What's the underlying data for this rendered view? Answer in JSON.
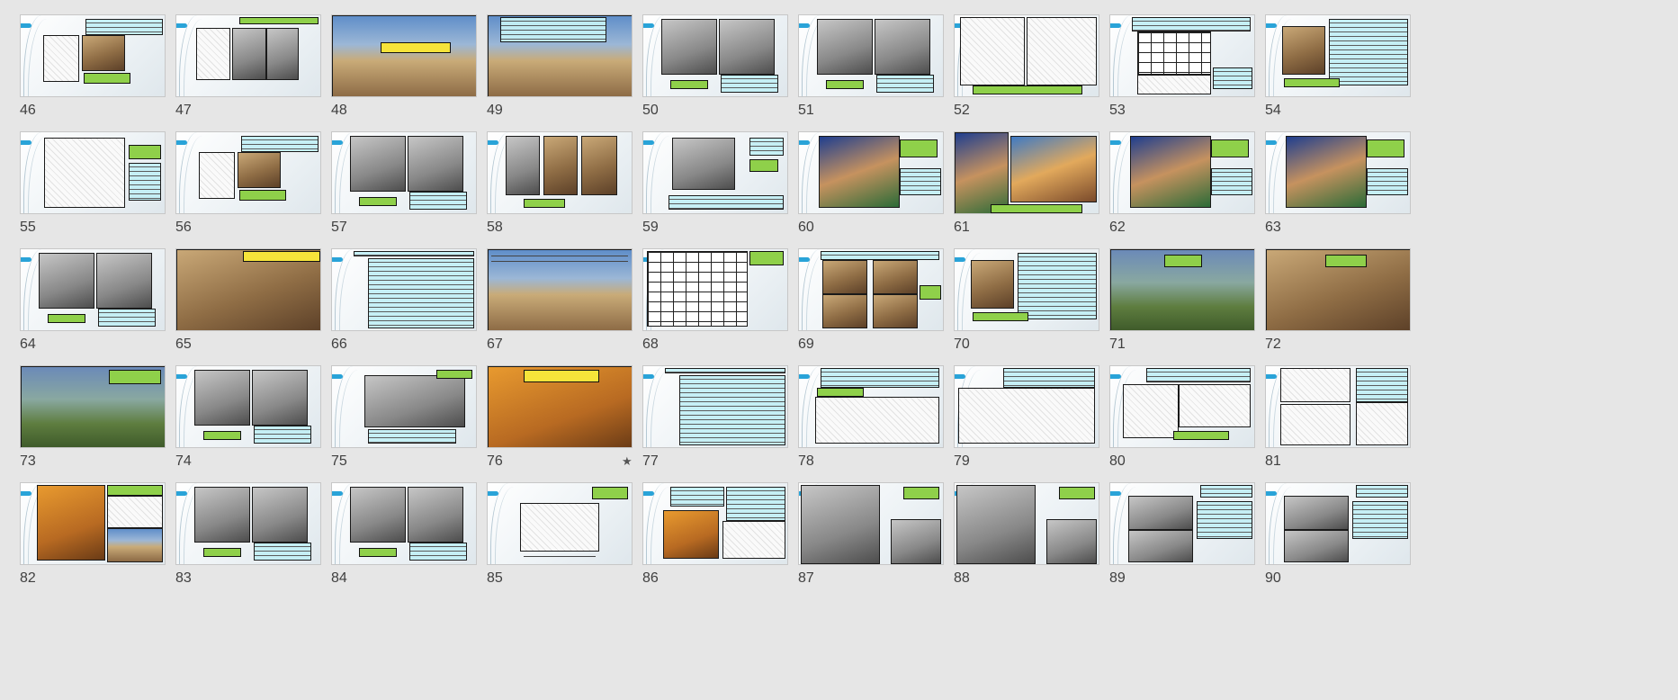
{
  "slides": [
    {
      "n": "46",
      "v": "a"
    },
    {
      "n": "47",
      "v": "b"
    },
    {
      "n": "48",
      "v": "f1"
    },
    {
      "n": "49",
      "v": "f2"
    },
    {
      "n": "50",
      "v": "c"
    },
    {
      "n": "51",
      "v": "c"
    },
    {
      "n": "52",
      "v": "s"
    },
    {
      "n": "53",
      "v": "p"
    },
    {
      "n": "54",
      "v": "d"
    },
    {
      "n": "55",
      "v": "e"
    },
    {
      "n": "56",
      "v": "a"
    },
    {
      "n": "57",
      "v": "c"
    },
    {
      "n": "58",
      "v": "g"
    },
    {
      "n": "59",
      "v": "h"
    },
    {
      "n": "60",
      "v": "m"
    },
    {
      "n": "61",
      "v": "m2"
    },
    {
      "n": "62",
      "v": "m"
    },
    {
      "n": "63",
      "v": "m"
    },
    {
      "n": "64",
      "v": "c"
    },
    {
      "n": "65",
      "v": "f3"
    },
    {
      "n": "66",
      "v": "t"
    },
    {
      "n": "67",
      "v": "f4"
    },
    {
      "n": "68",
      "v": "p2"
    },
    {
      "n": "69",
      "v": "q"
    },
    {
      "n": "70",
      "v": "d"
    },
    {
      "n": "71",
      "v": "f5"
    },
    {
      "n": "72",
      "v": "f6"
    },
    {
      "n": "73",
      "v": "f7"
    },
    {
      "n": "74",
      "v": "c"
    },
    {
      "n": "75",
      "v": "h2"
    },
    {
      "n": "76",
      "v": "f8",
      "star": "★"
    },
    {
      "n": "77",
      "v": "t"
    },
    {
      "n": "78",
      "v": "p3"
    },
    {
      "n": "79",
      "v": "p4"
    },
    {
      "n": "80",
      "v": "p5"
    },
    {
      "n": "81",
      "v": "p6"
    },
    {
      "n": "82",
      "v": "o"
    },
    {
      "n": "83",
      "v": "c"
    },
    {
      "n": "84",
      "v": "c"
    },
    {
      "n": "85",
      "v": "s2"
    },
    {
      "n": "86",
      "v": "s3"
    },
    {
      "n": "87",
      "v": "c2"
    },
    {
      "n": "88",
      "v": "c2"
    },
    {
      "n": "89",
      "v": "c3"
    },
    {
      "n": "90",
      "v": "c3"
    }
  ]
}
